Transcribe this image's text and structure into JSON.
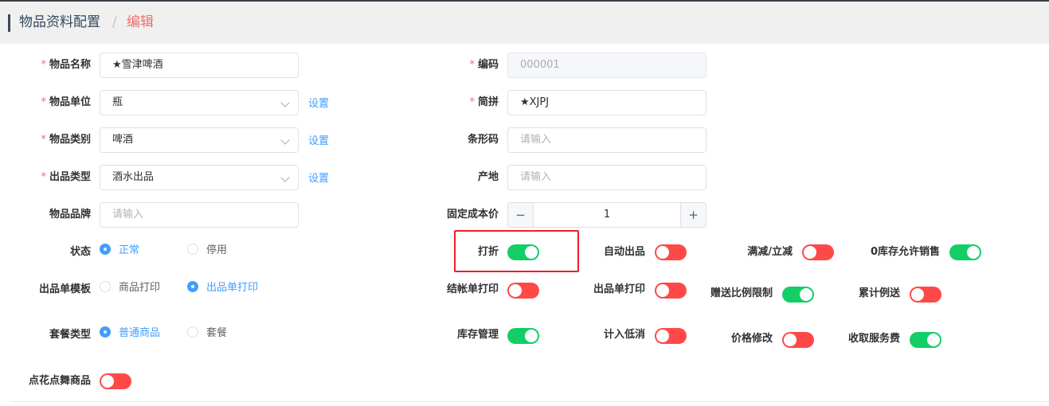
{
  "breadcrumb": {
    "home": "物品资料配置",
    "separator": "/",
    "current": "编辑"
  },
  "form": {
    "name": {
      "label": "物品名称",
      "value": "★雪津啤酒",
      "required": true
    },
    "unit": {
      "label": "物品单位",
      "value": "瓶",
      "required": true,
      "link": "设置"
    },
    "category": {
      "label": "物品类别",
      "value": "啤酒",
      "required": true,
      "link": "设置"
    },
    "output_type": {
      "label": "出品类型",
      "value": "酒水出品",
      "required": true,
      "link": "设置"
    },
    "brand": {
      "label": "物品品牌",
      "placeholder": "请输入"
    },
    "code": {
      "label": "编码",
      "value": "000001",
      "required": true,
      "disabled": true
    },
    "pinyin": {
      "label": "简拼",
      "value": "★XJPJ",
      "required": true
    },
    "barcode": {
      "label": "条形码",
      "placeholder": "请输入"
    },
    "origin": {
      "label": "产地",
      "placeholder": "请输入"
    },
    "cost": {
      "label": "固定成本价",
      "value": "1",
      "minus": "−",
      "plus": "+"
    },
    "status": {
      "label": "状态",
      "options": [
        "正常",
        "停用"
      ],
      "selected": "正常"
    },
    "template": {
      "label": "出品单模板",
      "options": [
        "商品打印",
        "出品单打印"
      ],
      "selected": "出品单打印"
    },
    "package": {
      "label": "套餐类型",
      "options": [
        "普通商品",
        "套餐"
      ],
      "selected": "普通商品"
    },
    "flower": {
      "label": "点花点舞商品",
      "on": false
    }
  },
  "switches": {
    "discount": {
      "label": "打折",
      "on": true
    },
    "auto_output": {
      "label": "自动出品",
      "on": false
    },
    "promo": {
      "label": "满减/立减",
      "on": false
    },
    "zero_stock": {
      "label": "0库存允许销售",
      "on": true
    },
    "checkout_print": {
      "label": "结帐单打印",
      "on": false
    },
    "output_print": {
      "label": "出品单打印",
      "on": false
    },
    "gift_ratio": {
      "label": "赠送比例限制",
      "on": true
    },
    "cumulative_gift": {
      "label": "累计例送",
      "on": false
    },
    "stock_mgmt": {
      "label": "库存管理",
      "on": true
    },
    "min_consume": {
      "label": "计入低消",
      "on": false
    },
    "price_edit": {
      "label": "价格修改",
      "on": false
    },
    "service_fee": {
      "label": "收取服务费",
      "on": true
    }
  },
  "colors": {
    "switch_on": "#13ce66",
    "switch_off": "#ff4949",
    "primary": "#409eff",
    "required": "#f56c6c",
    "highlight": "#e8202a"
  }
}
